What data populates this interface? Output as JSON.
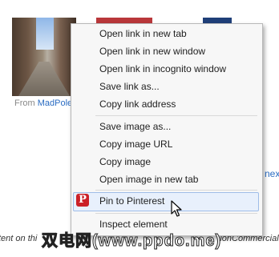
{
  "page": {
    "credit_prefix": "From ",
    "credit_link": "MadPole",
    "next_link": "nex",
    "footer_text": "tent on thi",
    "footer_tail": "ionCommercial-N",
    "watermark": "双电网(www.ppdo.me)"
  },
  "menu": {
    "groups": [
      [
        "Open link in new tab",
        "Open link in new window",
        "Open link in incognito window",
        "Save link as...",
        "Copy link address"
      ],
      [
        "Save image as...",
        "Copy image URL",
        "Copy image",
        "Open image in new tab"
      ],
      [
        "Pin to Pinterest"
      ],
      [
        "Inspect element"
      ]
    ]
  },
  "icons": {
    "pinterest": "pinterest-icon",
    "cursor": "mouse-pointer-icon"
  },
  "colors": {
    "pinterest_red": "#cb2027",
    "highlight": "#e8f0fc",
    "link": "#2a6cc2"
  }
}
